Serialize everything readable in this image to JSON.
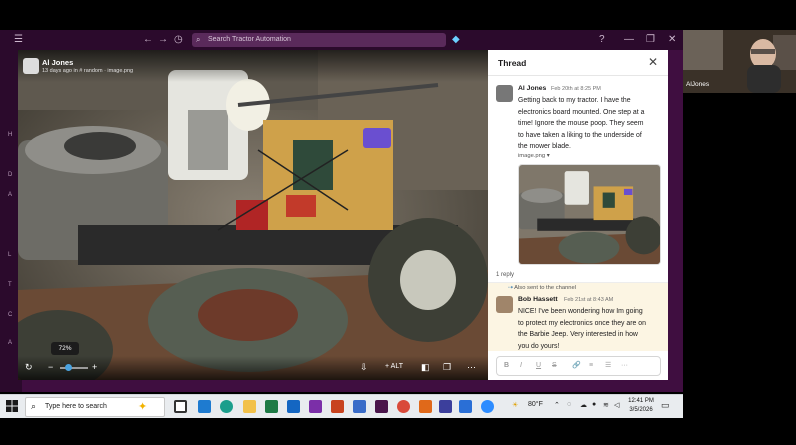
{
  "app": {
    "search_placeholder": "Search Tractor Automation",
    "sidebar_letters": [
      "H",
      "D",
      "A",
      "L",
      "T",
      "C",
      "A"
    ]
  },
  "viewer": {
    "author": "Al Jones",
    "meta": "13 days ago in  # random  ·  image.png",
    "zoom": "72%",
    "zoom_fraction": 0.72,
    "alt_label": "+ ALT"
  },
  "thread": {
    "title": "Thread",
    "messages": [
      {
        "author": "Al Jones",
        "time": "Feb 20th at 8:25 PM",
        "lines": [
          "Getting back to my tractor.  I have the",
          "electronics board mounted.  One step at a",
          "time!  Ignore the mouse poop.  They seem",
          "to have taken a liking to the underside of",
          "the mower blade."
        ],
        "attachment": "image.png"
      },
      {
        "author": "Bob Hassett",
        "time": "Feb 21st at 8:43 AM",
        "lines": [
          "NICE! I've been wondering how Im going",
          "to protect my electronics once they are on",
          "the Barbie Jeep. Very interested in how",
          "you do yours!"
        ]
      }
    ],
    "reply_count": "1 reply",
    "sent_note": "Also sent to the channel",
    "composer_buttons": [
      "B",
      "I",
      "U",
      "S",
      "🔗",
      "≡",
      "☰",
      "···"
    ]
  },
  "webcam": {
    "name": "AlJones"
  },
  "taskbar": {
    "search_placeholder": "Type here to search",
    "weather": "80°F",
    "time": "12:41 PM",
    "date": "3/5/2026"
  },
  "colors": {
    "slack_aubergine": "#3f0e40",
    "highlight": "#fcf5e3",
    "zoom_knob": "#4aa3e0"
  }
}
